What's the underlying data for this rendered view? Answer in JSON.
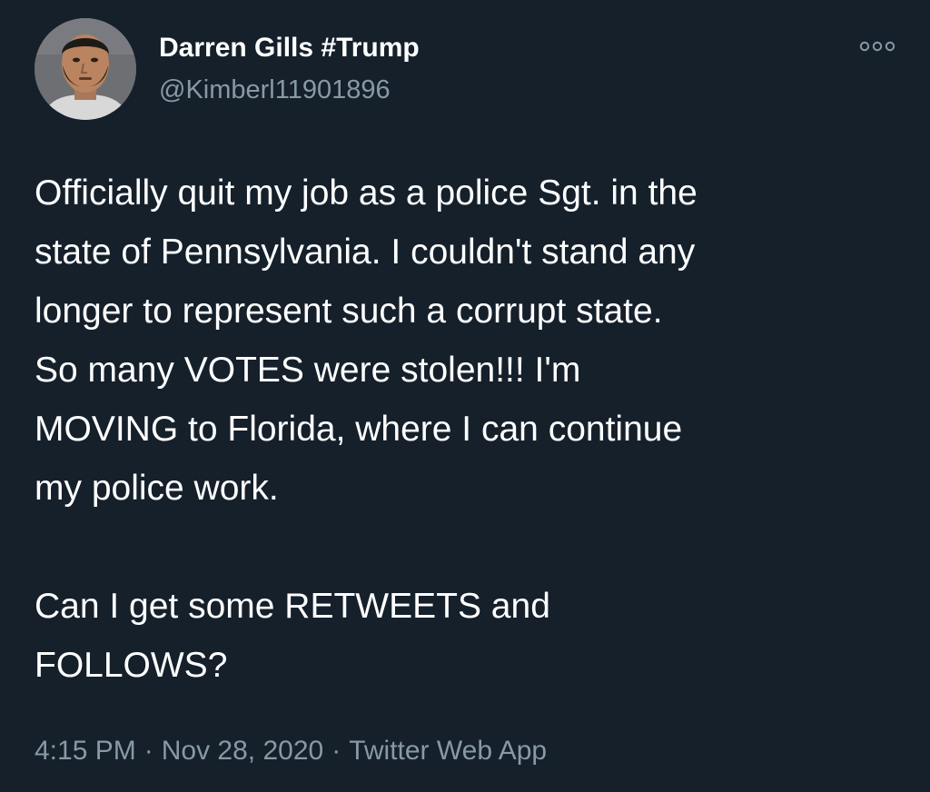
{
  "tweet": {
    "author": {
      "display_name": "Darren Gills #Trump",
      "handle": "@Kimberl11901896",
      "avatar_icon": "profile-photo"
    },
    "more_icon": "more-options-icon",
    "paragraphs": [
      "Officially quit my job as a police Sgt. in the\nstate of Pennsylvania. I couldn't stand any\nlonger to represent such a corrupt state.\nSo many VOTES were stolen!!! I'm\nMOVING to Florida, where I can continue\nmy police work.",
      "Can I get some RETWEETS and\nFOLLOWS?"
    ],
    "meta": {
      "time": "4:15 PM",
      "separator": "·",
      "date": "Nov 28, 2020",
      "source": "Twitter Web App"
    }
  },
  "colors": {
    "background": "#15202b",
    "primary_text": "#ffffff",
    "secondary_text": "#8899a6"
  }
}
